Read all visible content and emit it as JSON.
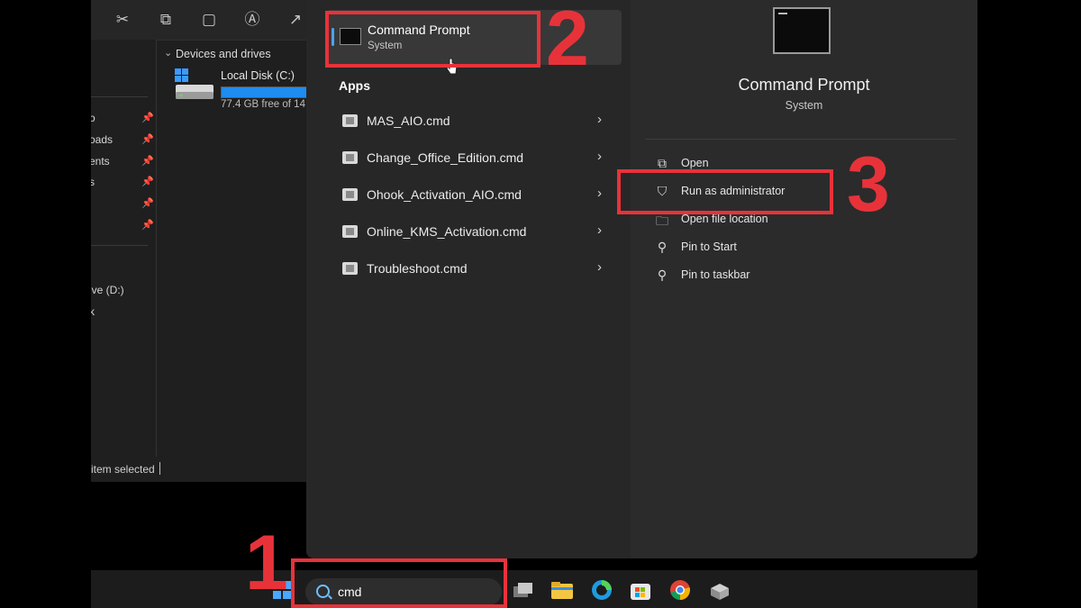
{
  "explorer": {
    "toolbar_icons": [
      "cut-icon",
      "copy-icon",
      "paste-icon",
      "rename-icon",
      "share-icon"
    ],
    "nav_items": [
      "o",
      "oads",
      "ents",
      "s",
      "",
      "",
      "ive (D:)",
      "k"
    ],
    "devices_title": "Devices and drives",
    "disk": {
      "name": "Local Disk (C:)",
      "free_text": "77.4 GB free of 14",
      "used_fraction": 0.85
    },
    "status": "item selected"
  },
  "search_panel": {
    "best_match": {
      "name": "Command Prompt",
      "type": "System"
    },
    "apps_heading": "Apps",
    "apps": [
      {
        "name": "MAS_AIO.cmd"
      },
      {
        "name": "Change_Office_Edition.cmd"
      },
      {
        "name": "Ohook_Activation_AIO.cmd"
      },
      {
        "name": "Online_KMS_Activation.cmd"
      },
      {
        "name": "Troubleshoot.cmd"
      }
    ],
    "detail": {
      "title": "Command Prompt",
      "subtitle": "System",
      "actions": [
        {
          "label": "Open",
          "icon": "open-icon"
        },
        {
          "label": "Run as administrator",
          "icon": "shield-icon"
        },
        {
          "label": "Open file location",
          "icon": "folder-icon"
        },
        {
          "label": "Pin to Start",
          "icon": "pin-icon"
        },
        {
          "label": "Pin to taskbar",
          "icon": "pin-icon"
        }
      ]
    }
  },
  "taskbar": {
    "search_value": "cmd",
    "apps": [
      "task-view-icon",
      "file-explorer-icon",
      "edge-icon",
      "store-icon",
      "chrome-icon",
      "installer-icon"
    ]
  },
  "annotations": {
    "step1": "1",
    "step2": "2",
    "step3": "3"
  },
  "colors": {
    "annotation": "#e8323a",
    "accent": "#4aa3ff",
    "disk_fill": "#1f8cf0"
  }
}
